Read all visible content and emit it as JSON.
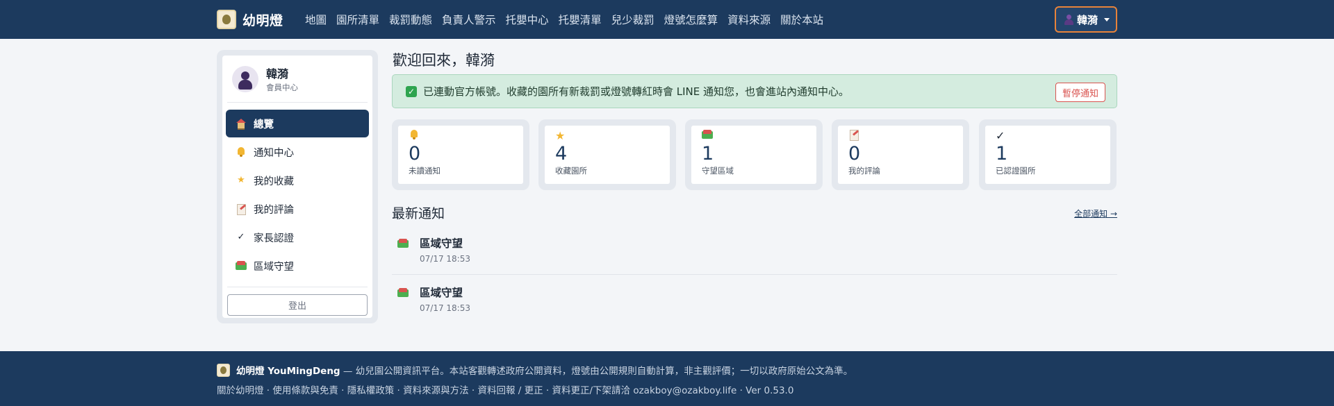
{
  "navbar": {
    "brand": "幼明燈",
    "links": [
      "地圖",
      "園所清單",
      "裁罰動態",
      "負責人警示",
      "托嬰中心",
      "托嬰清單",
      "兒少裁罰",
      "燈號怎麼算",
      "資料來源",
      "關於本站"
    ],
    "user": "韓漪"
  },
  "sidebar": {
    "name": "韓漪",
    "sub": "會員中心",
    "items": [
      {
        "label": "總覽",
        "icon": "house-icon",
        "active": true
      },
      {
        "label": "通知中心",
        "icon": "bell-icon"
      },
      {
        "label": "我的收藏",
        "icon": "star-icon"
      },
      {
        "label": "我的評論",
        "icon": "memo-icon"
      },
      {
        "label": "家長認證",
        "icon": "check-icon"
      },
      {
        "label": "區域守望",
        "icon": "houses-icon"
      }
    ],
    "logout": "登出"
  },
  "main": {
    "welcome": "歡迎回來，韓漪",
    "alert": {
      "text": "已連動官方帳號。收藏的園所有新裁罰或燈號轉紅時會 LINE 通知您，也會進站內通知中心。",
      "button": "暫停通知"
    },
    "stats": [
      {
        "value": "0",
        "label": "未讀通知",
        "icon": "bell-icon"
      },
      {
        "value": "4",
        "label": "收藏園所",
        "icon": "star-icon"
      },
      {
        "value": "1",
        "label": "守望區域",
        "icon": "houses-icon"
      },
      {
        "value": "0",
        "label": "我的評論",
        "icon": "memo-icon"
      },
      {
        "value": "1",
        "label": "已認證園所",
        "icon": "check-icon"
      }
    ],
    "notifications_title": "最新通知",
    "view_all": "全部通知 →",
    "notifications": [
      {
        "title": "區域守望",
        "time": "07/17 18:53"
      },
      {
        "title": "區域守望",
        "time": "07/17 18:53"
      }
    ]
  },
  "footer": {
    "brand": "幼明燈 YouMingDeng",
    "desc": "— 幼兒園公開資訊平台。本站客觀轉述政府公開資料，燈號由公開規則自動計算，非主觀評價；一切以政府原始公文為準。",
    "links": "關於幼明燈 · 使用條款與免責 · 隱私權政策 · 資料來源與方法 · 資料回報 / 更正 · 資料更正/下架請洽 ozakboy@ozakboy.life · Ver 0.53.0"
  },
  "colors": {
    "navy": "#1c3a5e",
    "accent_orange": "#e8833a",
    "alert_green": "#d4ecdf",
    "danger_red": "#d9534f"
  }
}
